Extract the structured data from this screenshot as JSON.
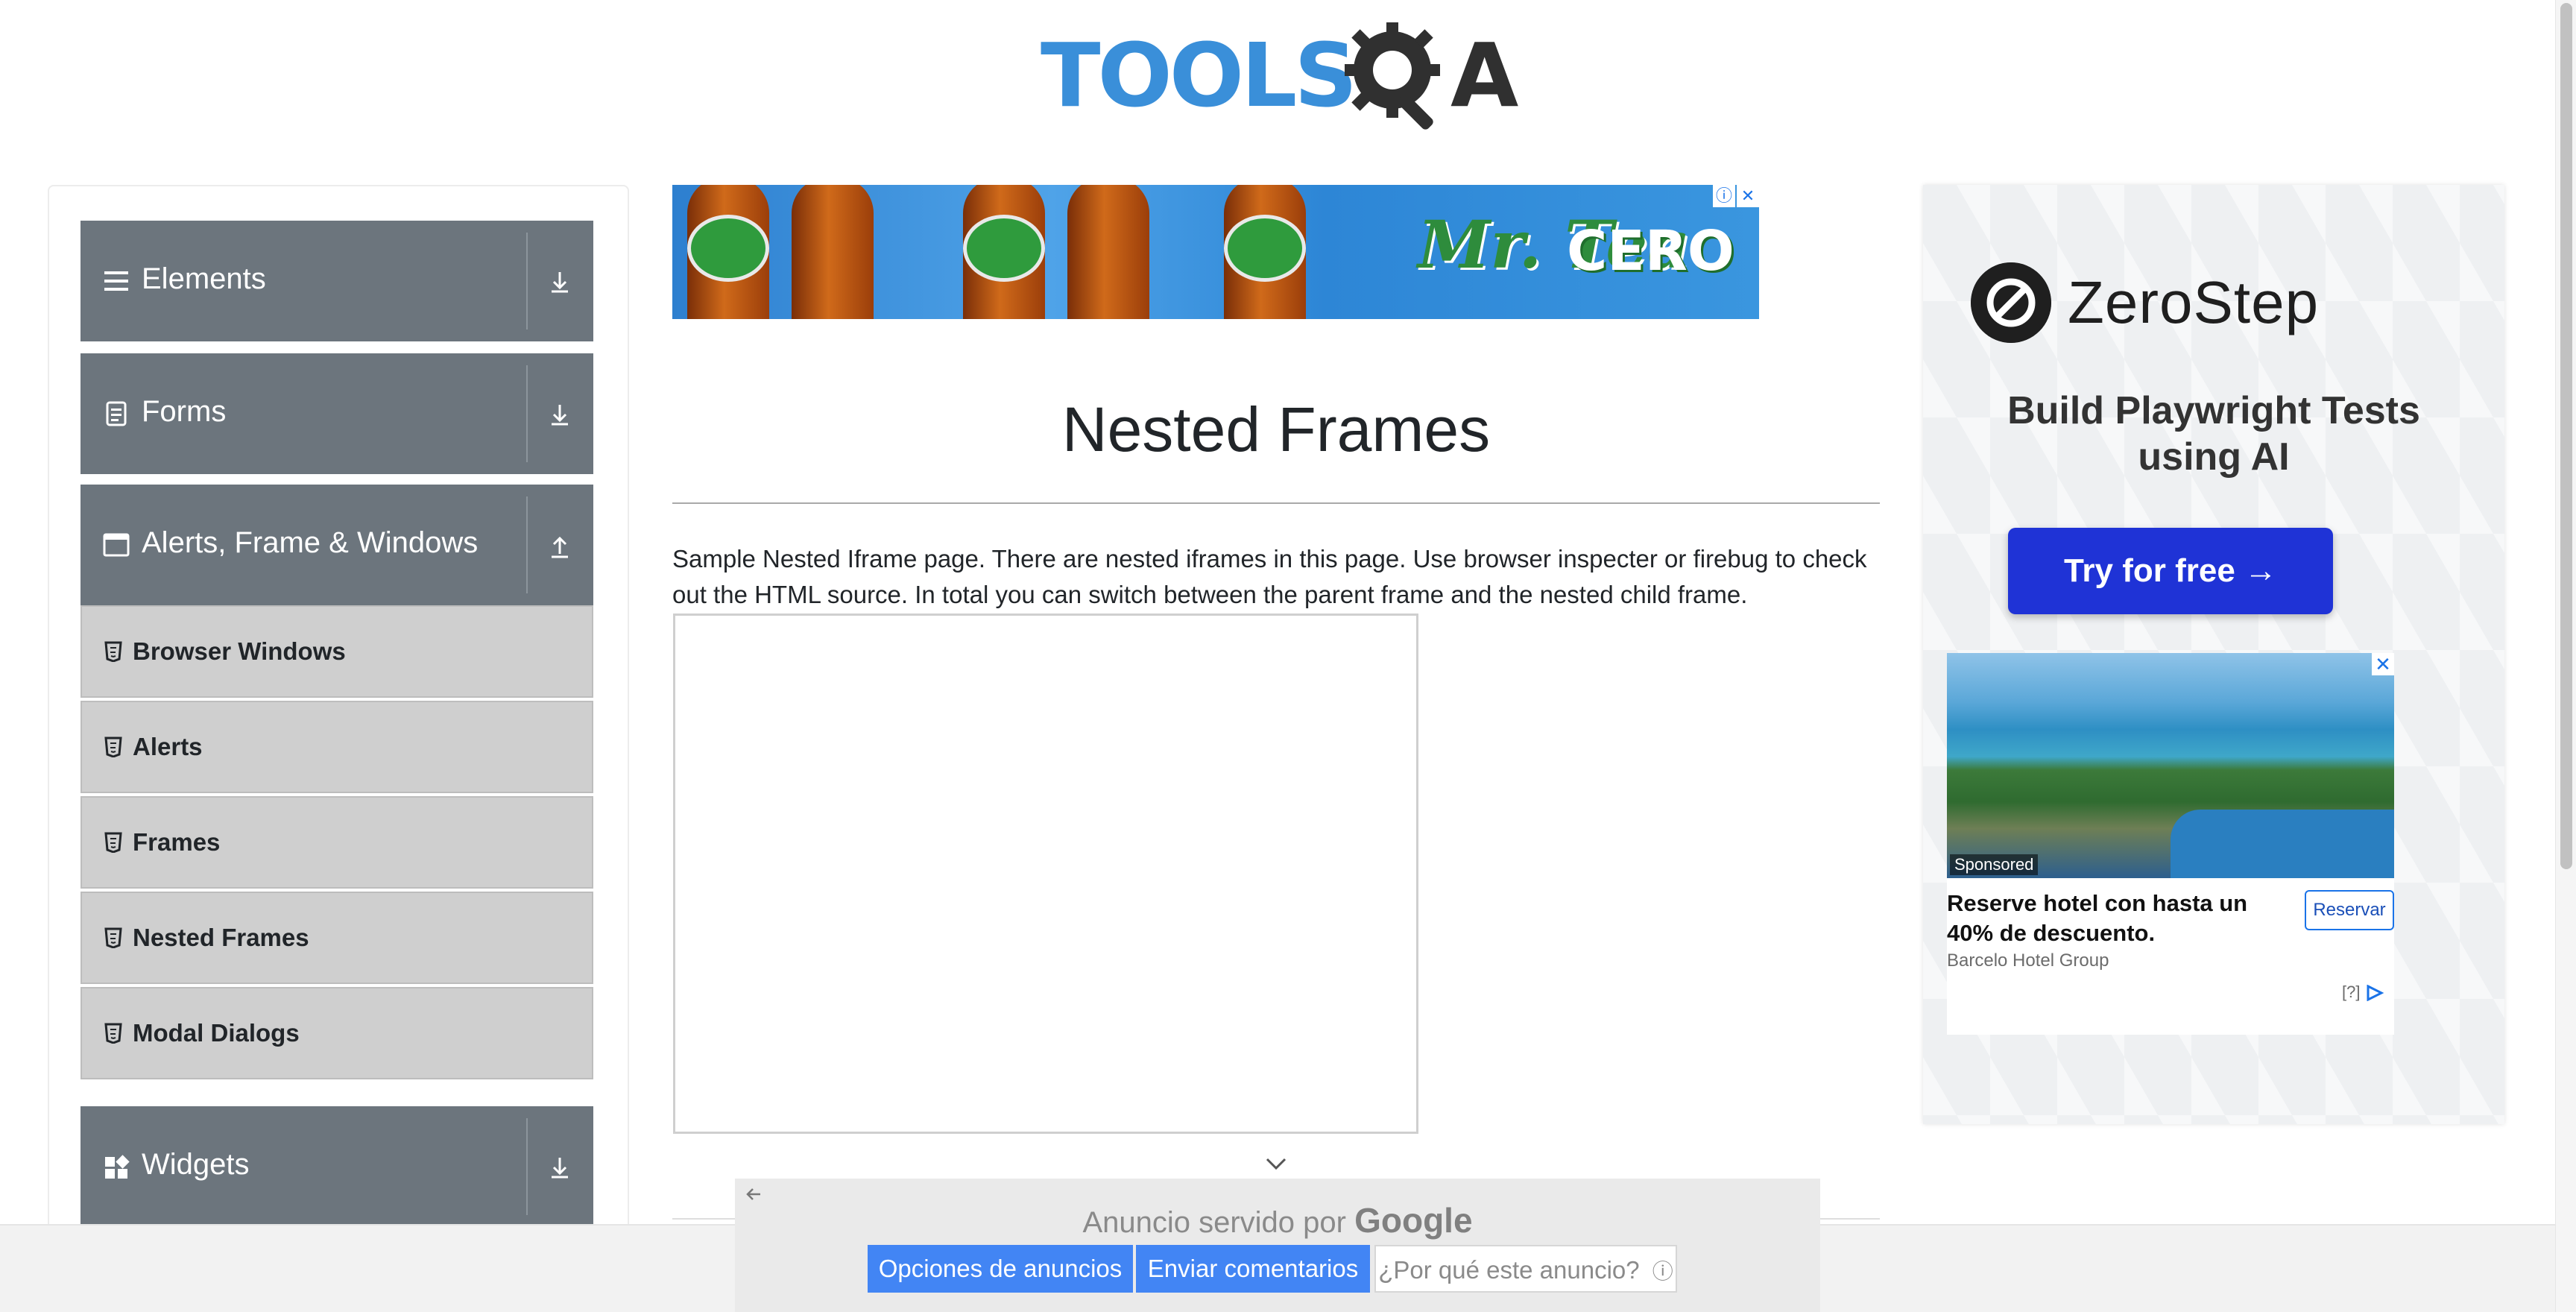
{
  "header": {
    "logo_text_left": "TOOLS",
    "logo_text_right": "A",
    "logo_icon": "gear-magnifier-icon"
  },
  "sidebar": {
    "groups": [
      {
        "label": "Elements",
        "icon": "hamburger-icon",
        "arrow": "download-arrow-icon"
      },
      {
        "label": "Forms",
        "icon": "document-icon",
        "arrow": "download-arrow-icon"
      },
      {
        "label": "Alerts, Frame & Windows",
        "icon": "window-icon",
        "arrow": "upload-arrow-icon",
        "items": [
          "Browser Windows",
          "Alerts",
          "Frames",
          "Nested Frames",
          "Modal Dialogs"
        ]
      },
      {
        "label": "Widgets",
        "icon": "widgets-icon",
        "arrow": "download-arrow-icon"
      }
    ]
  },
  "top_ad": {
    "brand": "Mr. Tea",
    "product": "CERO",
    "info_icon": "info-icon",
    "close_icon": "close-icon"
  },
  "main": {
    "title": "Nested Frames",
    "description": "Sample Nested Iframe page. There are nested iframes in this page. Use browser inspecter or firebug to check out the HTML source. In total you can switch between the parent frame and the nested child frame."
  },
  "right_ad": {
    "brand": "ZeroStep",
    "tagline": "Build Playwright Tests using AI",
    "cta": "Try for free →",
    "hotel": {
      "sponsored": "Sponsored",
      "title": "Reserve hotel con hasta un 40% de descuento.",
      "advertiser": "Barcelo Hotel Group",
      "button": "Reservar",
      "adchoices": "[?]"
    }
  },
  "google_bar": {
    "title_prefix": "Anuncio servido por",
    "title_brand": "Google",
    "buttons": [
      "Opciones de anuncios",
      "Enviar comentarios",
      "¿Por qué este anuncio?"
    ]
  },
  "colors": {
    "sidebar_header": "#6c757d",
    "sidebar_item": "#cfcfcf",
    "logo_blue": "#3a8fd9",
    "google_button": "#4285f4",
    "zerostep_cta": "#1f33d6"
  }
}
